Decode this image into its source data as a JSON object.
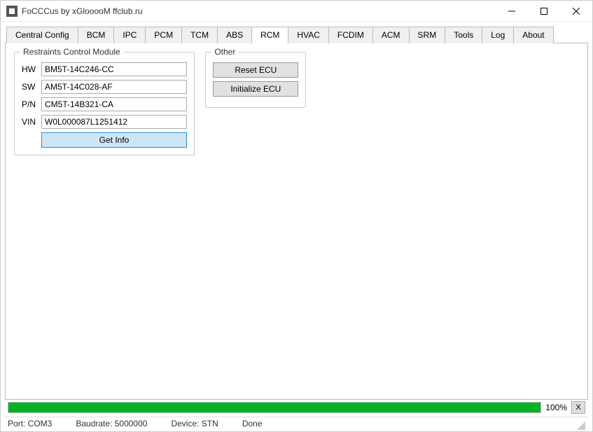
{
  "window": {
    "title": "FoCCCus by xGlooooM ffclub.ru"
  },
  "tabs": [
    {
      "label": "Central Config",
      "active": false
    },
    {
      "label": "BCM",
      "active": false
    },
    {
      "label": "IPC",
      "active": false
    },
    {
      "label": "PCM",
      "active": false
    },
    {
      "label": "TCM",
      "active": false
    },
    {
      "label": "ABS",
      "active": false
    },
    {
      "label": "RCM",
      "active": true
    },
    {
      "label": "HVAC",
      "active": false
    },
    {
      "label": "FCDIM",
      "active": false
    },
    {
      "label": "ACM",
      "active": false
    },
    {
      "label": "SRM",
      "active": false
    },
    {
      "label": "Tools",
      "active": false
    },
    {
      "label": "Log",
      "active": false
    },
    {
      "label": "About",
      "active": false
    }
  ],
  "rcm_group": {
    "legend": "Restraints Control Module",
    "fields": {
      "hw_label": "HW",
      "hw_value": "BM5T-14C246-CC",
      "sw_label": "SW",
      "sw_value": "AM5T-14C028-AF",
      "pn_label": "P/N",
      "pn_value": "CM5T-14B321-CA",
      "vin_label": "VIN",
      "vin_value": "W0L000087L1251412"
    },
    "get_info_label": "Get Info"
  },
  "other_group": {
    "legend": "Other",
    "reset_label": "Reset ECU",
    "init_label": "Initialize ECU"
  },
  "progress": {
    "percent_label": "100%",
    "cancel_label": "X"
  },
  "status": {
    "port": "Port: COM3",
    "baud": "Baudrate: 5000000",
    "device": "Device: STN",
    "state": "Done"
  }
}
